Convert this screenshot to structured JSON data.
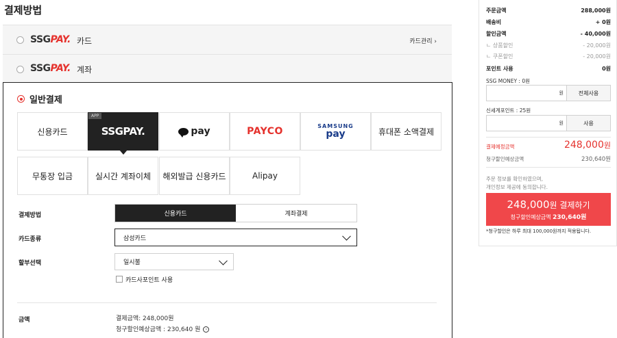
{
  "page_title": "결제방법",
  "ssgpay_card": {
    "logo_a": "SSG",
    "logo_b": "PAY.",
    "suffix": "카드",
    "link": "카드관리",
    "link_icon": "chevron-right-icon"
  },
  "ssgpay_account": {
    "logo_a": "SSG",
    "logo_b": "PAY.",
    "suffix": "계좌"
  },
  "general": {
    "title": "일반결제",
    "methods": [
      {
        "label": "신용카드"
      },
      {
        "label": "SSGPAY.",
        "tag": "APP",
        "selected": true
      },
      {
        "label": "pay"
      },
      {
        "label": "PAYCO"
      },
      {
        "label_top": "SAMSUNG",
        "label_bottom": "pay"
      },
      {
        "label": "휴대폰 소액결제"
      },
      {
        "label": "무통장 입금"
      },
      {
        "label": "실시간 계좌이체"
      },
      {
        "label": "해외발급 신용카드"
      },
      {
        "label": "Alipay"
      }
    ]
  },
  "form": {
    "method_label": "결제방법",
    "method_options": [
      "신용카드",
      "계좌결제"
    ],
    "card_type_label": "카드종류",
    "card_type_value": "삼성카드",
    "installment_label": "할부선택",
    "installment_value": "일시불",
    "point_checkbox": "카드사포인트 사용",
    "amount_label": "금액",
    "amount_line1": "결제금액: 248,000원",
    "amount_line2": "청구할인예상금액 : 230,640 원"
  },
  "summary": {
    "order_amount_label": "주문금액",
    "order_amount": "288,000원",
    "shipping_label": "배송비",
    "shipping": "+ 0원",
    "discount_label": "할인금액",
    "discount": "- 40,000원",
    "product_discount_label": "ㄴ 상품할인",
    "product_discount": "- 20,000원",
    "coupon_discount_label": "ㄴ 쿠폰할인",
    "coupon_discount": "- 20,000원",
    "point_use_label": "포인트 사용",
    "point_use": "0원",
    "ssg_money_label": "SSG MONEY : 0원",
    "won": "원",
    "use_all_button": "전체사용",
    "shinsegae_point_label": "신세계포인트 : 25원",
    "use_button": "사용",
    "due_label": "결제예정금액",
    "due_value": "248,000",
    "due_unit": "원",
    "est_label": "청구할인예상금액",
    "est_value": "230,640원",
    "agree_line1": "주문 정보를 확인하였으며,",
    "agree_line2": "개인정보 제공에 동의합니다.",
    "pay_amount": "248,000",
    "pay_unit": "원 결제하기",
    "pay_sub_label": "청구할인예상금액",
    "pay_sub_value": "230,640원",
    "footnote": "*청구할인은 하루 최대 100,000원까지 적용됩니다."
  },
  "colors": {
    "accent": "#e5322d",
    "pay_button": "#f0474a",
    "dark": "#222222"
  }
}
